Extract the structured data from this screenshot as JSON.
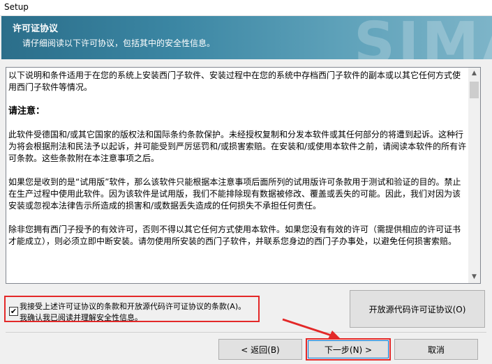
{
  "window": {
    "title": "Setup"
  },
  "header": {
    "title": "许可证协议",
    "subtitle": "请仔细阅读以下许可协议，包括其中的安全性信息。",
    "brand_watermark": "SIMA"
  },
  "license": {
    "paragraphs": [
      {
        "text": "以下说明和条件适用于在您的系统上安装西门子软件、安装过程中在您的系统中存档西门子软件的副本或以其它任何方式使用西门子软件等情况。",
        "bold": false
      },
      {
        "text": "请注意：",
        "bold": true
      },
      {
        "text": "此软件受德国和/或其它国家的版权法和国际条约条款保护。未经授权复制和分发本软件或其任何部分的将遭到起诉。这种行为将会根据刑法和民法予以起诉，并可能受到严厉惩罚和/或损害索赔。在安装和/或使用本软件之前，请阅读本软件的所有许可条款。这些条款附在本注意事项之后。",
        "bold": false
      },
      {
        "text": "如果您是收到的是“试用版”软件，那么该软件只能根据本注意事项后面所列的试用版许可条款用于测试和验证的目的。禁止在生产过程中使用此软件。因为该软件是试用版，我们不能排除现有数据被修改、覆盖或丢失的可能。因此，我们对因为该安装或忽视本法律告示所造成的损害和/或数据丢失造成的任何损失不承担任何责任。",
        "bold": false
      },
      {
        "text": "除非您拥有西门子授予的有效许可，否则不得以其它任何方式使用本软件。如果您没有有效的许可（需提供相应的许可证书才能成立），则必须立即中断安装。请勿使用所安装的西门子软件，并联系您身边的西门子办事处，以避免任何损害索赔。",
        "bold": false
      }
    ]
  },
  "accept": {
    "checked": true,
    "check_glyph": "✔",
    "line1": "我接受上述许可证协议的条款和开放源代码许可证协议的条款(A)。",
    "line2": "我确认我已阅读并理解安全性信息。"
  },
  "buttons": {
    "open_source": "开放源代码许可证协议(O)",
    "back": "< 返回(B)",
    "next": "下一步(N) >",
    "cancel": "取消"
  },
  "scrollbar": {
    "up_glyph": "▲",
    "down_glyph": "▼"
  },
  "colors": {
    "highlight": "#e32828",
    "banner": "#3b86a3"
  }
}
